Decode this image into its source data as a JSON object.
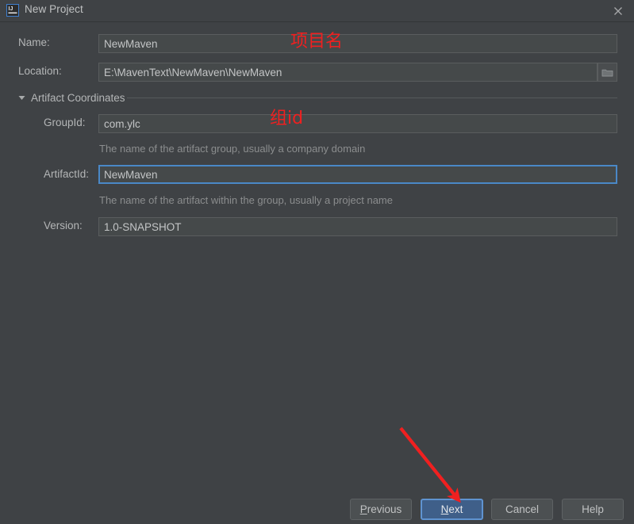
{
  "window": {
    "title": "New Project",
    "app_icon": "intellij-idea-icon",
    "close_icon": "close-icon",
    "background_color": "#3f4245"
  },
  "form": {
    "fields": [
      {
        "key": "name",
        "label": "Name:",
        "value": "NewMaven",
        "focused": false,
        "hint": ""
      },
      {
        "key": "location",
        "label": "Location:",
        "value": "E:\\MavenText\\NewMaven\\NewMaven",
        "focused": false,
        "hint": ""
      }
    ],
    "browse_icon": "folder-browse-icon"
  },
  "section": {
    "title": "Artifact Coordinates",
    "expanded": true,
    "triangle_icon": "chevron-down-icon",
    "fields": [
      {
        "key": "groupid",
        "label": "GroupId:",
        "value": "com.ylc",
        "focused": false,
        "hint": "The name of the artifact group, usually a company domain"
      },
      {
        "key": "artifactid",
        "label": "ArtifactId:",
        "value": "NewMaven",
        "focused": true,
        "hint": "The name of the artifact within the group, usually a project name"
      },
      {
        "key": "version",
        "label": "Version:",
        "value": "1.0-SNAPSHOT",
        "focused": false,
        "hint": ""
      }
    ]
  },
  "buttons": [
    {
      "key": "previous",
      "label": "Previous",
      "mnemonic": "P",
      "primary": false
    },
    {
      "key": "next",
      "label": "Next",
      "mnemonic": "N",
      "primary": true
    },
    {
      "key": "cancel",
      "label": "Cancel",
      "mnemonic": "",
      "primary": false
    },
    {
      "key": "help",
      "label": "Help",
      "mnemonic": "",
      "primary": false
    }
  ],
  "annotations": [
    {
      "key": "project-name",
      "text": "项目名",
      "color": "#f02020"
    },
    {
      "key": "group-id",
      "text": "组id",
      "color": "#f02020"
    }
  ],
  "arrow": {
    "color": "#f02020",
    "points_to": "next-button"
  }
}
